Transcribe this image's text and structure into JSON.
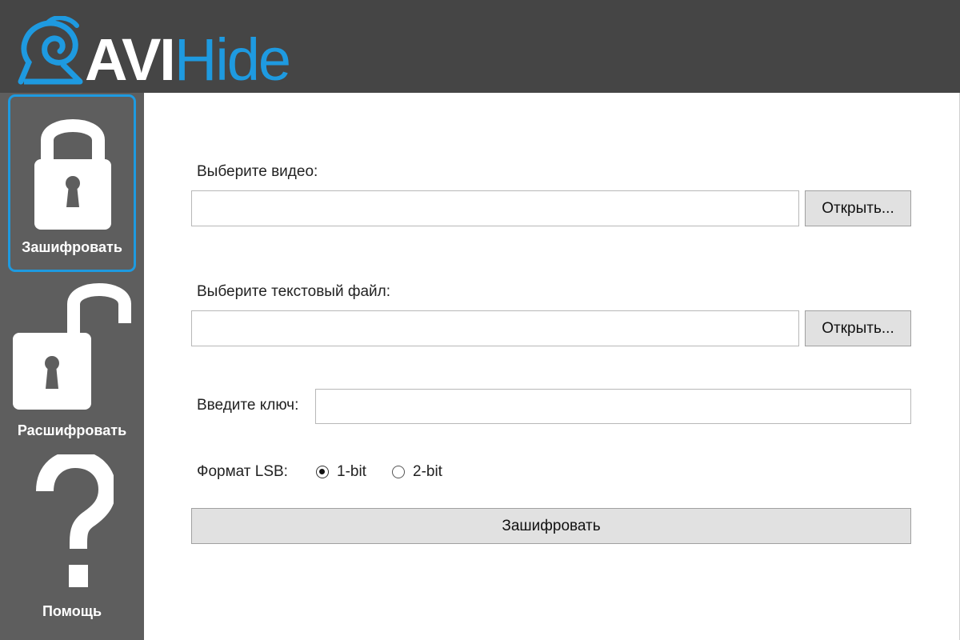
{
  "app": {
    "logo_avi": "AVI",
    "logo_hide": "Hide",
    "accent_color": "#1e9ae0"
  },
  "sidebar": {
    "items": [
      {
        "label": "Зашифровать",
        "icon": "lock-closed-icon",
        "active": true
      },
      {
        "label": "Расшифровать",
        "icon": "lock-open-icon",
        "active": false
      },
      {
        "label": "Помощь",
        "icon": "question-mark-icon",
        "active": false
      }
    ]
  },
  "form": {
    "video_label": "Выберите видео:",
    "video_value": "",
    "video_open_button": "Открыть...",
    "text_label": "Выберите текстовый файл:",
    "text_value": "",
    "text_open_button": "Открыть...",
    "key_label": "Введите ключ:",
    "key_value": "",
    "lsb_label": "Формат LSB:",
    "lsb_options": [
      {
        "label": "1-bit",
        "checked": true
      },
      {
        "label": "2-bit",
        "checked": false
      }
    ],
    "submit_button": "Зашифровать"
  }
}
